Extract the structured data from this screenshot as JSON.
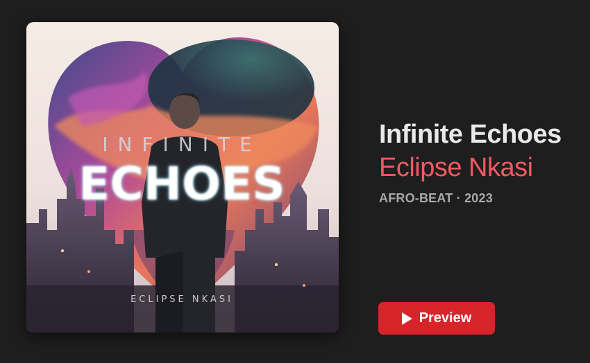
{
  "album": {
    "artwork_title_small": "INFINITE",
    "artwork_title_large": "ECHOES",
    "artwork_artist": "ECLIPSE NKASI",
    "title": "Infinite Echoes",
    "artist": "Eclipse Nkasi",
    "genre": "AFRO-BEAT",
    "separator": "·",
    "year": "2023"
  },
  "actions": {
    "preview_label": "Preview",
    "preview_icon": "play-icon"
  },
  "colors": {
    "background": "#1e1e1e",
    "accent_artist": "#f25a63",
    "preview_button": "#d8232a"
  }
}
